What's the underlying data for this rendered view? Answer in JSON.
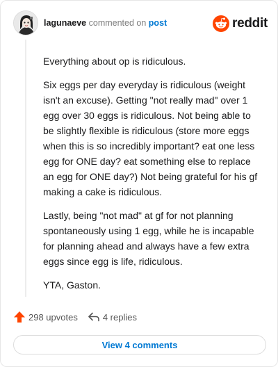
{
  "comment": {
    "username": "lagunaeve",
    "action_text": "commented on",
    "post_link": "post",
    "paragraphs": [
      "Everything about op is ridiculous.",
      "Six eggs per day everyday is ridiculous (weight isn't an excuse). Getting \"not really mad\" over 1 egg over 30 eggs is ridiculous. Not being able to be slightly flexible is ridiculous (store more eggs when this is so incredibly important? eat one less egg for ONE day? eat something else to replace an egg for ONE day?) Not being grateful for his gf making a cake is ridiculous.",
      "Lastly, being \"not mad\" at gf for not planning spontaneously using 1 egg, while he is incapable for planning ahead and always have a few extra eggs since egg is life, ridiculous.",
      "YTA, Gaston."
    ],
    "upvotes": "298 upvotes",
    "replies": "4 replies",
    "view_comments": "View 4 comments"
  },
  "brand": {
    "wordmark": "reddit",
    "icon": "reddit-snoo-icon"
  },
  "colors": {
    "brand_orange": "#ff4500",
    "link_blue": "#0079d3",
    "upvote_orange": "#ff4500"
  }
}
